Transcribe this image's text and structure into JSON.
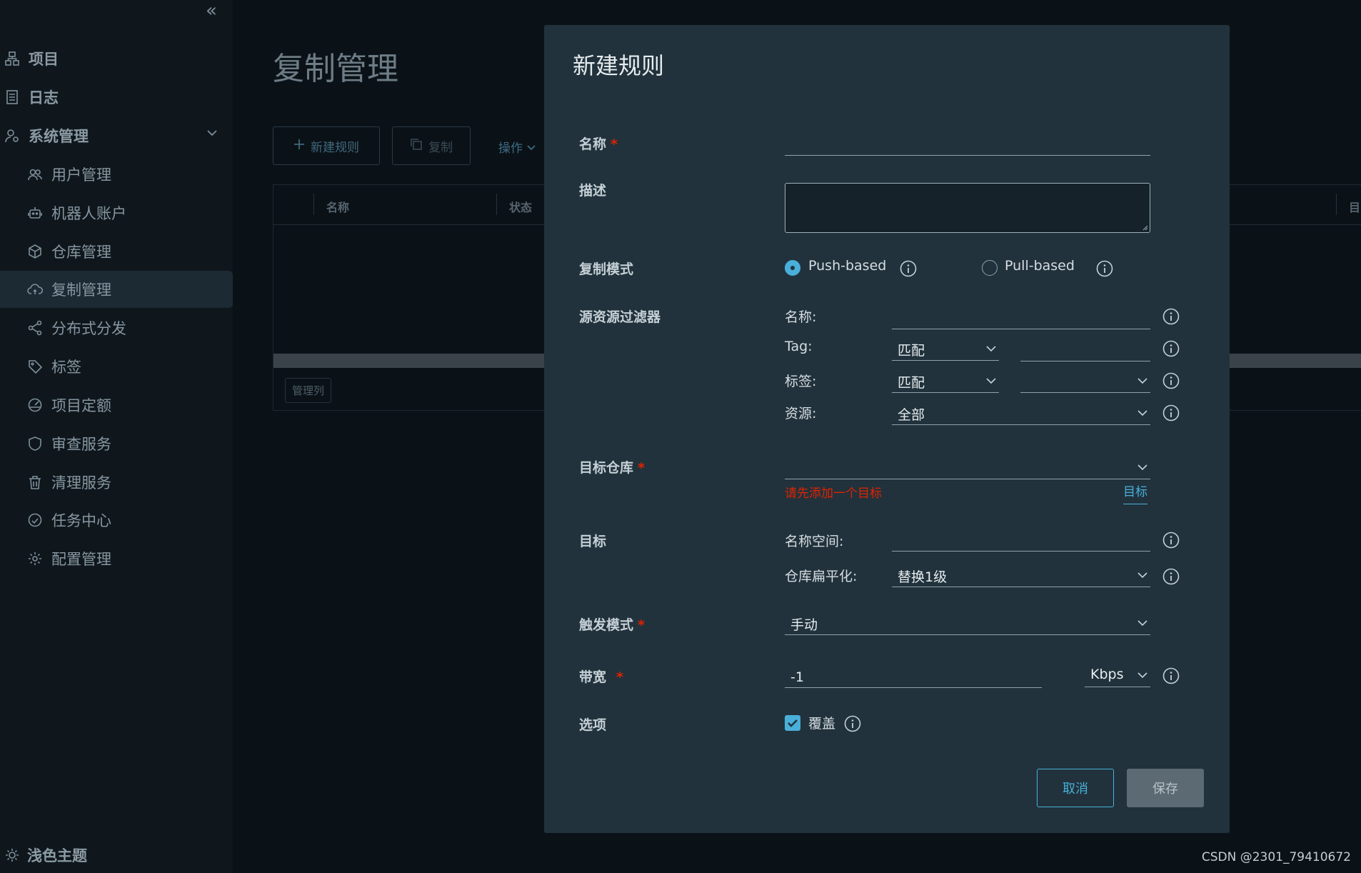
{
  "sidebar": {
    "items": [
      {
        "label": "项目",
        "icon": "project-icon"
      },
      {
        "label": "日志",
        "icon": "log-icon"
      },
      {
        "label": "系统管理",
        "icon": "admin-icon"
      },
      {
        "label": "用户管理",
        "icon": "users-icon"
      },
      {
        "label": "机器人账户",
        "icon": "robot-icon"
      },
      {
        "label": "仓库管理",
        "icon": "registry-icon"
      },
      {
        "label": "复制管理",
        "icon": "cloud-sync-icon"
      },
      {
        "label": "分布式分发",
        "icon": "share-icon"
      },
      {
        "label": "标签",
        "icon": "tag-icon"
      },
      {
        "label": "项目定额",
        "icon": "quota-icon"
      },
      {
        "label": "审查服务",
        "icon": "shield-icon"
      },
      {
        "label": "清理服务",
        "icon": "trash-icon"
      },
      {
        "label": "任务中心",
        "icon": "dashboard-icon"
      },
      {
        "label": "配置管理",
        "icon": "gear-icon"
      }
    ],
    "theme_toggle": "浅色主题"
  },
  "main": {
    "title": "复制管理",
    "new_rule_button": "新建规则",
    "copy_button": "复制",
    "actions_link": "操作",
    "columns": [
      "名称",
      "状态",
      "目"
    ],
    "manage_columns_button": "管理列"
  },
  "modal": {
    "title": "新建规则",
    "name_label": "名称",
    "name_value": "",
    "desc_label": "描述",
    "mode_label": "复制模式",
    "push_label": "Push-based",
    "pull_label": "Pull-based",
    "mode_selected": "Push-based",
    "filter_label": "源资源过滤器",
    "filter_name_label": "名称:",
    "filter_name_value": "",
    "filter_tag_label": "Tag:",
    "filter_tag_match": "匹配",
    "filter_tag_value": "",
    "filter_label_label": "标签:",
    "filter_label_match": "匹配",
    "filter_label_value": "",
    "filter_resource_label": "资源:",
    "filter_resource_value": "全部",
    "dest_registry_label": "目标仓库",
    "dest_registry_value": "",
    "dest_registry_error": "请先添加一个目标",
    "dest_registry_link": "目标",
    "target_label": "目标",
    "namespace_label": "名称空间:",
    "namespace_value": "",
    "flatten_label": "仓库扁平化:",
    "flatten_value": "替换1级",
    "trigger_label": "触发模式",
    "trigger_value": "手动",
    "bandwidth_label": "带宽",
    "bandwidth_value": "-1",
    "bandwidth_unit": "Kbps",
    "options_label": "选项",
    "override_label": "覆盖",
    "override_checked": true,
    "cancel_button": "取消",
    "save_button": "保存"
  },
  "watermark": "CSDN @2301_79410672",
  "colors": {
    "accent": "#49afd9",
    "error": "#e12200",
    "modal_bg": "#21323c",
    "page_bg": "#0b1217"
  }
}
